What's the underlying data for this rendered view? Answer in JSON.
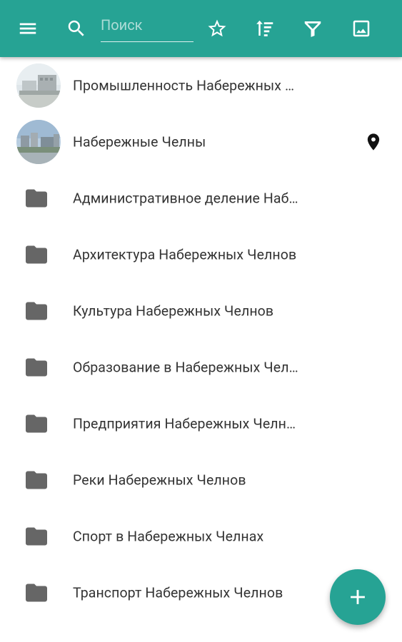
{
  "toolbar": {
    "background_color": "#26A394",
    "search_placeholder": "Поиск",
    "search_value": "",
    "icons": [
      "menu-icon",
      "search-icon",
      "star-icon",
      "sort-icon",
      "filter-icon",
      "image-icon"
    ]
  },
  "list": {
    "items": [
      {
        "label": "Промышленность Набережных …",
        "leading": "photo-thumbnail",
        "trailing": ""
      },
      {
        "label": "Набережные Челны",
        "leading": "photo-thumbnail",
        "trailing": "location-pin-icon"
      },
      {
        "label": "Административное деление Наб…",
        "leading": "folder-icon"
      },
      {
        "label": "Архитектура Набережных Челнов",
        "leading": "folder-icon"
      },
      {
        "label": "Культура Набережных Челнов",
        "leading": "folder-icon"
      },
      {
        "label": "Образование в Набережных Чел…",
        "leading": "folder-icon"
      },
      {
        "label": "Предприятия Набережных Челн…",
        "leading": "folder-icon"
      },
      {
        "label": "Реки Набережных Челнов",
        "leading": "folder-icon"
      },
      {
        "label": "Спорт в Набережных Челнах",
        "leading": "folder-icon"
      },
      {
        "label": "Транспорт Набережных Челнов",
        "leading": "folder-icon"
      }
    ]
  },
  "fab": {
    "icon": "plus-icon",
    "color": "#26A394"
  }
}
